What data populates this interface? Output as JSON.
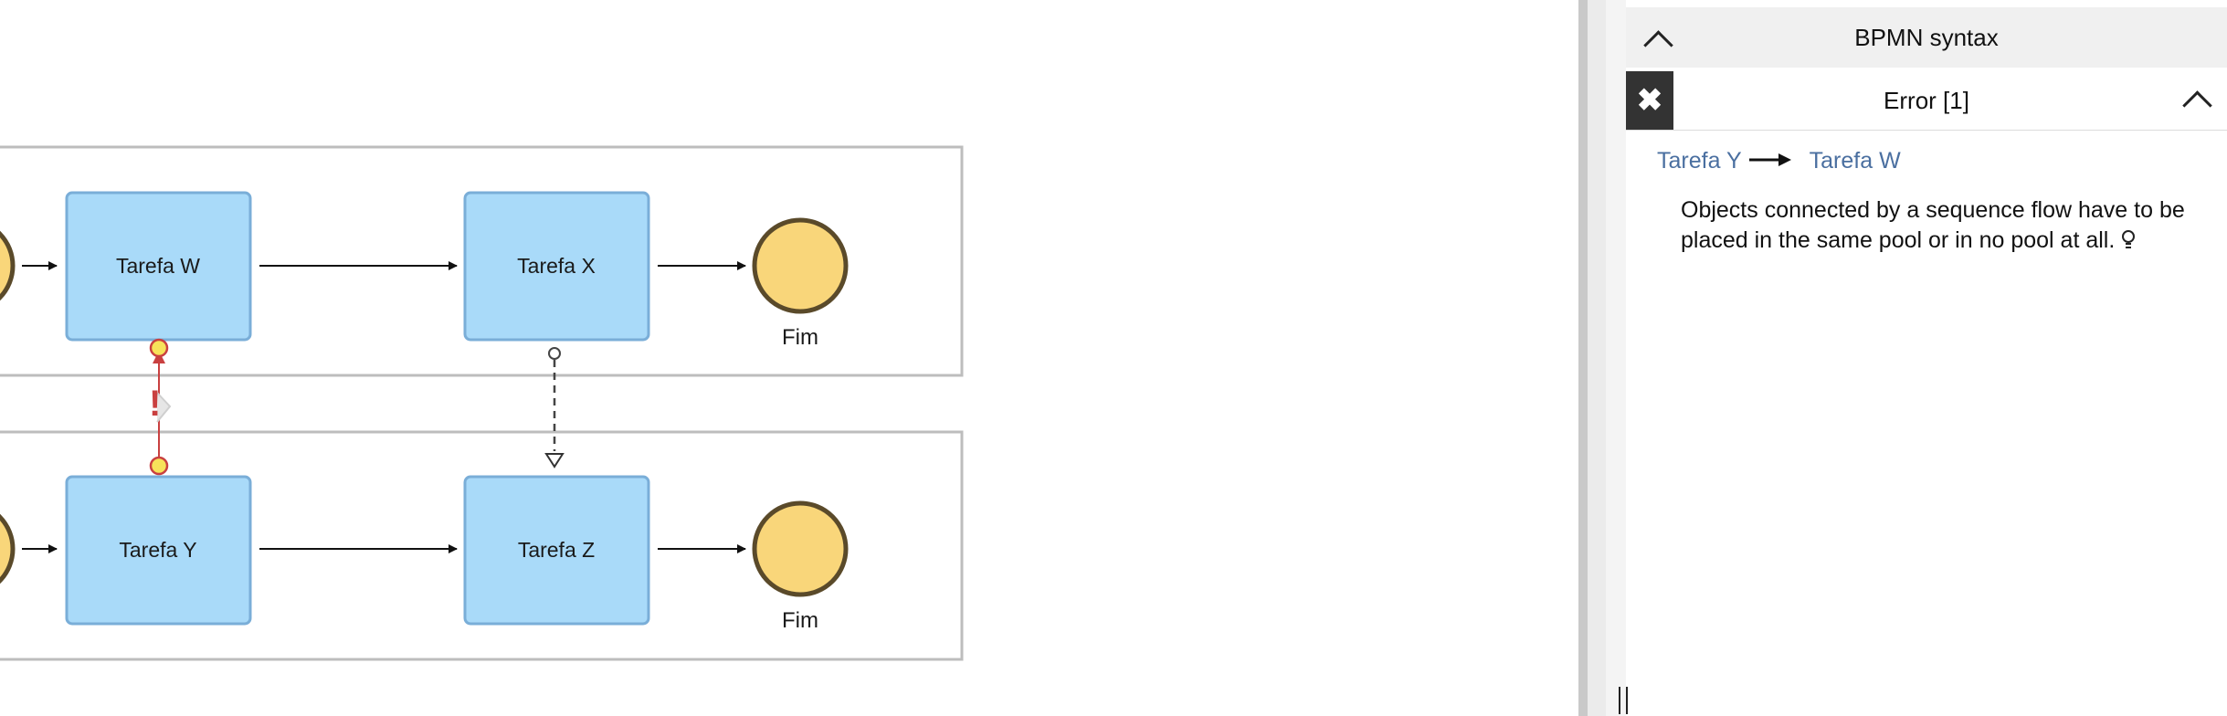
{
  "diagram": {
    "lanes": [
      {
        "tasks": [
          "Tarefa W",
          "Tarefa X"
        ],
        "end_label": "Fim"
      },
      {
        "tasks": [
          "Tarefa Y",
          "Tarefa Z"
        ],
        "end_label": "Fim"
      }
    ],
    "error_marker": "!",
    "colors": {
      "task_fill": "#a9daf9",
      "task_stroke": "#7aaed8",
      "event_fill": "#f9d67a",
      "event_stroke": "#5a4a2a",
      "error": "#c94040"
    }
  },
  "panel": {
    "header_title": "BPMN syntax",
    "error_title": "Error [1]",
    "close_icon": "close-icon",
    "link_from": "Tarefa Y",
    "link_to": "Tarefa W",
    "message": "Objects connected by a sequence flow have to be placed in the same pool or in no pool at all.",
    "hint_icon": "lightbulb-icon"
  }
}
